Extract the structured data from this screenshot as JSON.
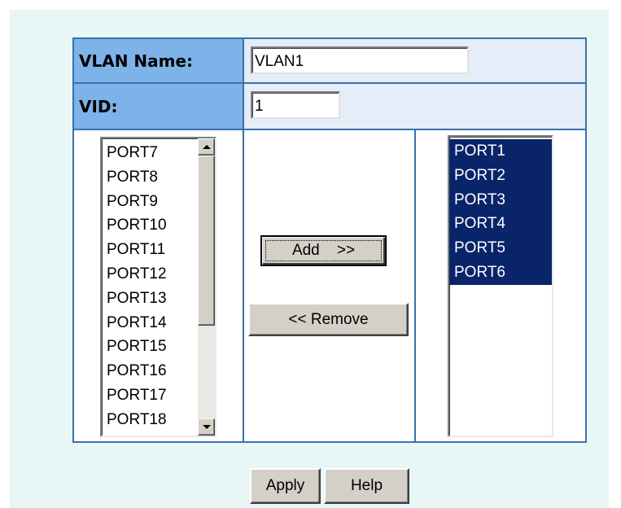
{
  "form": {
    "vlan_name": {
      "label": "VLAN Name:",
      "value": "VLAN1"
    },
    "vid": {
      "label": "VID:",
      "value": "1"
    }
  },
  "available_ports": {
    "items": [
      "PORT7",
      "PORT8",
      "PORT9",
      "PORT10",
      "PORT11",
      "PORT12",
      "PORT13",
      "PORT14",
      "PORT15",
      "PORT16",
      "PORT17",
      "PORT18"
    ]
  },
  "member_ports": {
    "items": [
      "PORT1",
      "PORT2",
      "PORT3",
      "PORT4",
      "PORT5",
      "PORT6"
    ]
  },
  "buttons": {
    "add": "Add    >>",
    "remove": "<< Remove",
    "apply": "Apply",
    "help": "Help"
  },
  "colors": {
    "label_bg": "#7db3e8",
    "value_bg": "#e5edf9",
    "table_border": "#3a72a8",
    "selection": "#0a246a",
    "page_bg": "#e8f6f6"
  }
}
